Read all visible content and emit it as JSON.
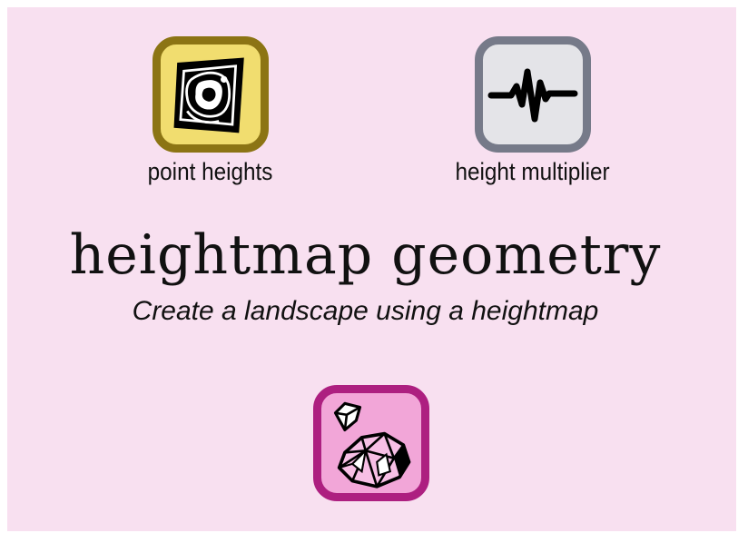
{
  "inputs": [
    {
      "label": "point heights",
      "icon": "contour-map-icon",
      "tile_fill": "#f1dd6f",
      "tile_border": "#8c7414"
    },
    {
      "label": "height multiplier",
      "icon": "waveform-icon",
      "tile_fill": "#e4e4e8",
      "tile_border": "#767a89"
    }
  ],
  "title": "heightmap geometry",
  "subtitle": "Create a landscape using a heightmap",
  "output": {
    "icon": "gem-icon",
    "tile_fill": "#f2a6d8",
    "tile_border": "#ad1f80"
  },
  "colors": {
    "background": "#f8e0f0",
    "text": "#111111"
  }
}
